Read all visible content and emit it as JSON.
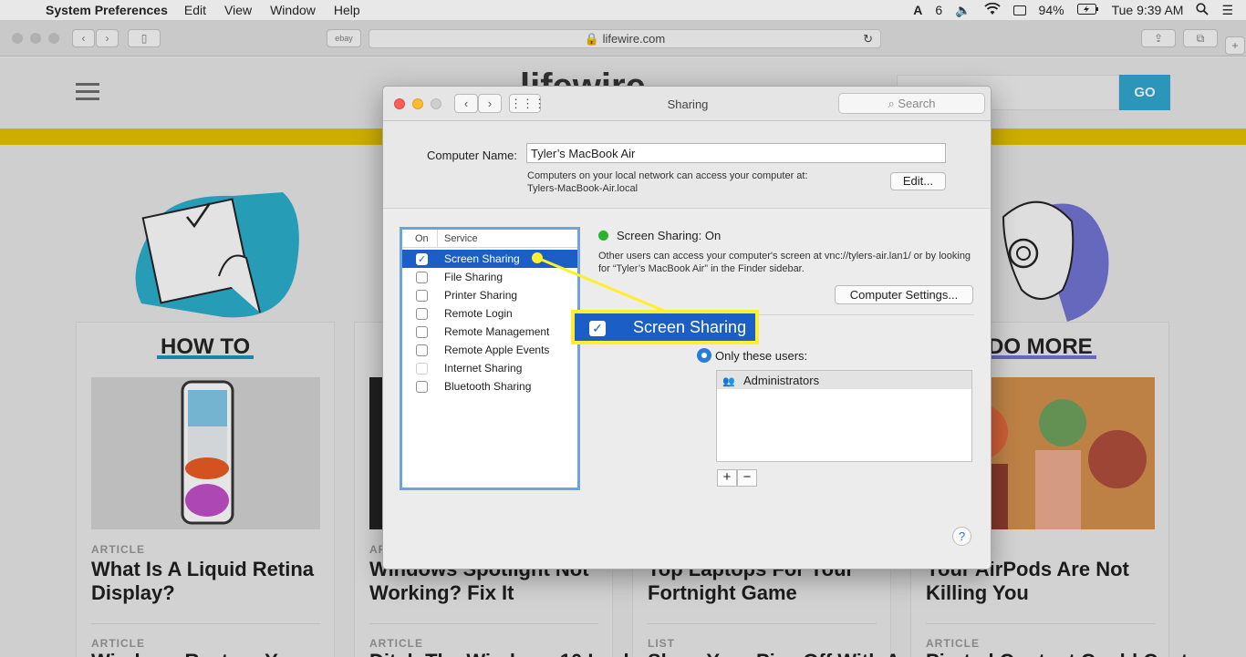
{
  "menubar": {
    "app": "System Preferences",
    "menus": [
      "Edit",
      "View",
      "Window",
      "Help"
    ],
    "adobe_count": "6",
    "battery": "94%",
    "clock": "Tue 9:39 AM"
  },
  "browser": {
    "bookmark": "ebay",
    "url": "lifewire.com",
    "go_label": "GO"
  },
  "page": {
    "logo": "lifewire",
    "sections": [
      {
        "heading": "HOW TO",
        "kind": "ARTICLE",
        "title": "What Is A Liquid Retina Display?",
        "kind2": "ARTICLE",
        "title2": "Windows Restore Y..."
      },
      {
        "heading": "",
        "kind": "ARTICLE",
        "title": "Windows Spotlight Not Working? Fix It",
        "kind2": "ARTICLE",
        "title2": "Ditch The Windows 10 Lock..."
      },
      {
        "heading": "",
        "kind": "LIST",
        "title": "Top Laptops For Your Fortnight Game",
        "kind2": "LIST",
        "title2": "Show Your Pics Off With A..."
      },
      {
        "heading": "DO MORE",
        "kind": "ARTICLE",
        "title": "Your AirPods Are Not Killing You",
        "kind2": "ARTICLE",
        "title2": "Pirated Content Could Cost..."
      }
    ]
  },
  "dialog": {
    "title": "Sharing",
    "search_placeholder": "Search",
    "computer_name_label": "Computer Name:",
    "computer_name_value": "Tyler’s MacBook Air",
    "note_line1": "Computers on your local network can access your computer at:",
    "note_line2": "Tylers-MacBook-Air.local",
    "edit_label": "Edit...",
    "col_on": "On",
    "col_service": "Service",
    "services": [
      {
        "label": "Screen Sharing",
        "checked": true
      },
      {
        "label": "File Sharing",
        "checked": false
      },
      {
        "label": "Printer Sharing",
        "checked": false
      },
      {
        "label": "Remote Login",
        "checked": false
      },
      {
        "label": "Remote Management",
        "checked": false
      },
      {
        "label": "Remote Apple Events",
        "checked": false
      },
      {
        "label": "Internet Sharing",
        "checked": false
      },
      {
        "label": "Bluetooth Sharing",
        "checked": false
      }
    ],
    "status": "Screen Sharing: On",
    "status_desc": "Other users can access your computer's screen at vnc://tylers-air.lan1/ or by looking for “Tyler’s MacBook Air” in the Finder sidebar.",
    "computer_settings_label": "Computer Settings...",
    "only_users_label": "Only these users:",
    "users": [
      "Administrators"
    ],
    "help_label": "?",
    "colors": {
      "selection": "#1a5ec6",
      "status_on": "#2bb32b"
    }
  },
  "callout": {
    "label": "Screen Sharing",
    "color": "#ffef2e"
  }
}
